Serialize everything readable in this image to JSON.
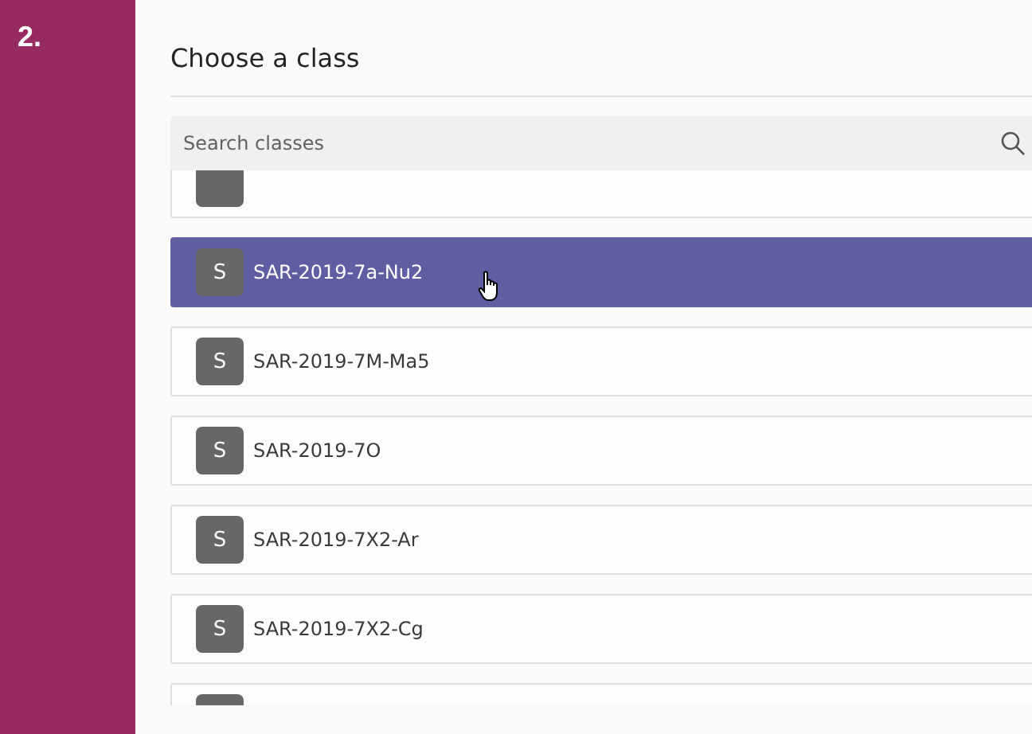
{
  "step": "2.",
  "dialog": {
    "title": "Choose a class",
    "search": {
      "placeholder": "Search classes"
    },
    "classes": [
      {
        "selected": false
      },
      {
        "initial": "S",
        "name": "SAR-2019-7a-Nu2",
        "selected": true
      },
      {
        "initial": "S",
        "name": "SAR-2019-7M-Ma5",
        "selected": false
      },
      {
        "initial": "S",
        "name": "SAR-2019-7O",
        "selected": false
      },
      {
        "initial": "S",
        "name": "SAR-2019-7X2-Ar",
        "selected": false
      },
      {
        "initial": "S",
        "name": "SAR-2019-7X2-Cg",
        "selected": false
      },
      {
        "selected": false
      }
    ]
  }
}
